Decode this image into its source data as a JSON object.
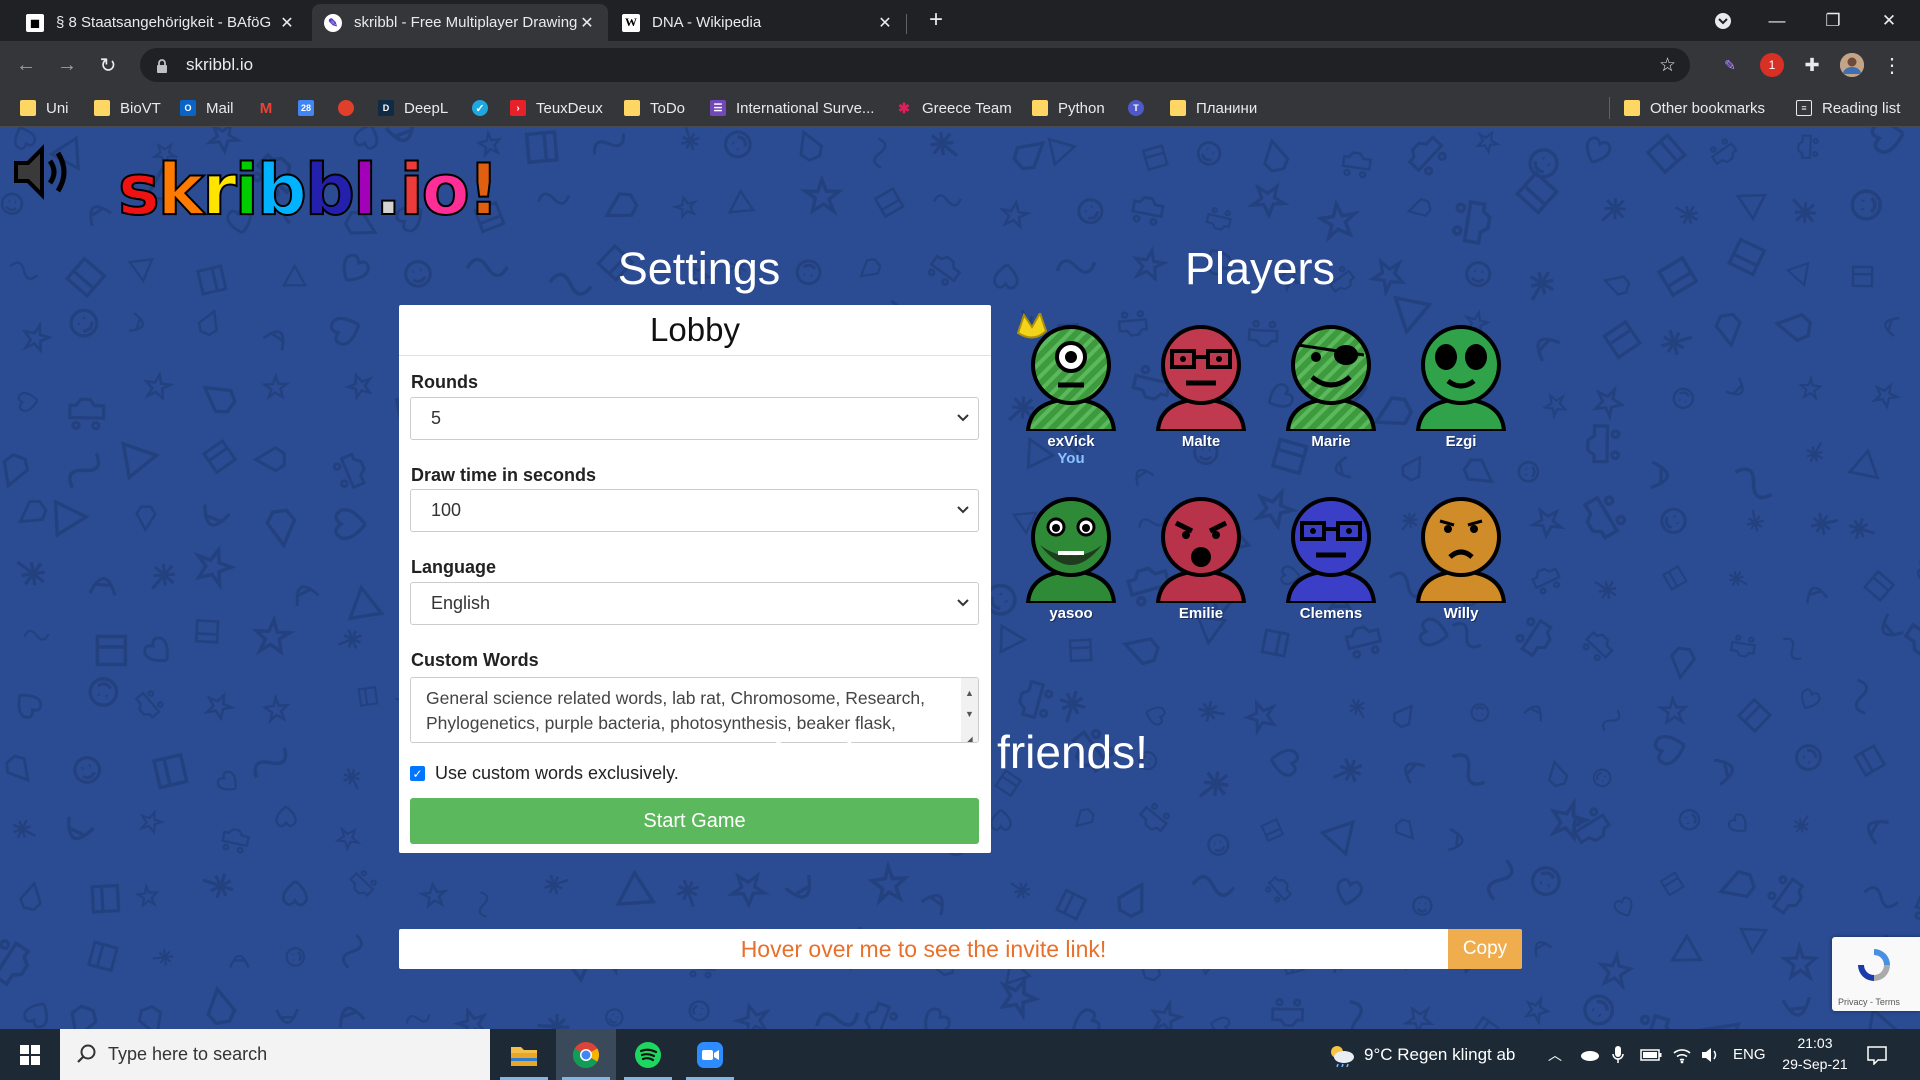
{
  "browser": {
    "tabs": [
      {
        "title": "§ 8 Staatsangehörigkeit - BAföG"
      },
      {
        "title": "skribbl - Free Multiplayer Drawing"
      },
      {
        "title": "DNA - Wikipedia"
      }
    ],
    "url": "skribbl.io",
    "bookmarks": [
      "Uni",
      "BioVT",
      "Mail",
      "DeepL",
      "TeuxDeux",
      "ToDo",
      "International Surve...",
      "Greece Team",
      "Python",
      "Планини"
    ],
    "other_bookmarks": "Other bookmarks",
    "reading_list": "Reading list",
    "calendar_day": "28",
    "ext_badge": "1"
  },
  "game": {
    "logo_letters": [
      "s",
      "k",
      "r",
      "i",
      "b",
      "b",
      "l",
      ".",
      "i",
      "o",
      "!"
    ],
    "logo_colors": [
      "#ef1212",
      "#ff7a00",
      "#ffe400",
      "#00cc00",
      "#00b2ff",
      "#2320ad",
      "#a300ba",
      "#d2d2d2",
      "#ed3b3b",
      "#ff2d96",
      "#e05f10"
    ],
    "settings_title": "Settings",
    "players_title": "Players",
    "lobby": "Lobby",
    "rounds_label": "Rounds",
    "rounds_value": "5",
    "drawtime_label": "Draw time in seconds",
    "drawtime_value": "100",
    "language_label": "Language",
    "language_value": "English",
    "custom_words_label": "Custom Words",
    "custom_words_text": "General science related words, lab rat, Chromosome, Research, Phylogenetics, purple bacteria, photosynthesis, beaker flask,",
    "checkbox_label": "Use custom words exclusively.",
    "start_button": "Start Game",
    "invite_title": "Invite your friends!",
    "invite_placeholder": "Hover over me to see the invite link!",
    "copy_button": "Copy",
    "recaptcha_text": "Privacy - Terms",
    "players": [
      {
        "name": "exVick",
        "you": "You",
        "color": "#3d9a3d",
        "pattern": "stripes",
        "eyes": "cyclops",
        "crown": true
      },
      {
        "name": "Malte",
        "color": "#c0394f",
        "pattern": "none",
        "eyes": "glasses"
      },
      {
        "name": "Marie",
        "color": "#3d9a3d",
        "pattern": "stripes",
        "eyes": "patch"
      },
      {
        "name": "Ezgi",
        "color": "#2fa24a",
        "pattern": "none",
        "eyes": "big"
      },
      {
        "name": "yasoo",
        "color": "#2f8a38",
        "pattern": "none",
        "eyes": "beard"
      },
      {
        "name": "Emilie",
        "color": "#b8324a",
        "pattern": "none",
        "eyes": "shout"
      },
      {
        "name": "Clemens",
        "color": "#3b3fc8",
        "pattern": "none",
        "eyes": "glasses"
      },
      {
        "name": "Willy",
        "color": "#d18c2a",
        "pattern": "none",
        "eyes": "sad"
      }
    ]
  },
  "taskbar": {
    "search_placeholder": "Type here to search",
    "weather": "9°C  Regen klingt ab",
    "lang": "ENG",
    "time": "21:03",
    "date": "29-Sep-21"
  }
}
